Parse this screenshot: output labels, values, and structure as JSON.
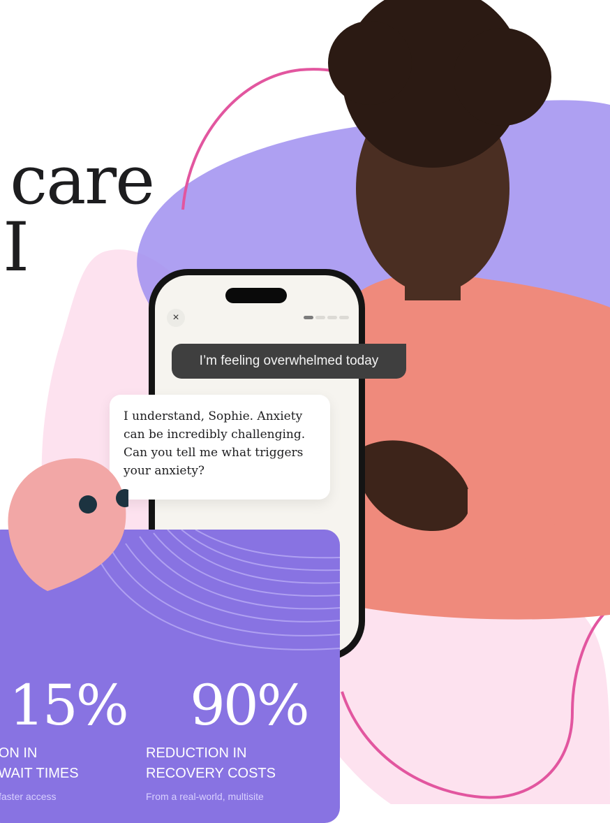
{
  "hero": {
    "line1": "care",
    "line2": "I"
  },
  "chat": {
    "close_icon": "×",
    "user_message": "I’m feeling overwhelmed today",
    "ai_message": "I understand, Sophie. Anxiety can be incredibly challenging. Can you tell me what triggers your anxiety?"
  },
  "stats": [
    {
      "value": "15%",
      "label": "TION IN\nT WAIT TIMES",
      "note": "faster access"
    },
    {
      "value": "90%",
      "label": "REDUCTION IN\nRECOVERY COSTS",
      "note": "From a real-world, multisite"
    }
  ],
  "colors": {
    "accent_purple": "#8873e2",
    "blob_pink": "#fde2ef",
    "line_magenta": "#e2569f",
    "bubble_dark": "#3f3f3f"
  }
}
